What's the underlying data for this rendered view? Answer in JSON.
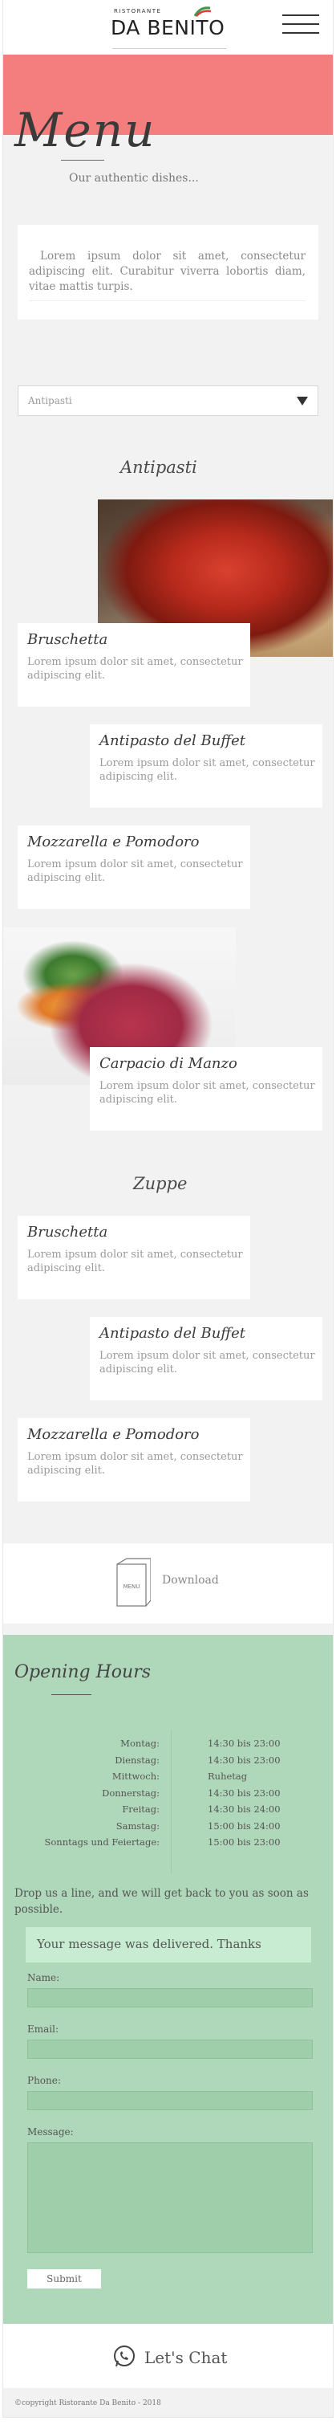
{
  "header": {
    "logo_small": "RISTORANTE",
    "logo_big": "DA BENITO"
  },
  "hero": {
    "title": "Menu",
    "subtitle": "Our authentic dishes..."
  },
  "intro": {
    "text": "Lorem ipsum dolor sit amet, consectetur adipiscing elit. Curabitur viverra lobortis diam, vitae mattis turpis."
  },
  "category_select": {
    "selected": "Antipasti"
  },
  "sections": {
    "antipasti": {
      "title": "Antipasti",
      "items": [
        {
          "name": "Bruschetta",
          "desc": "Lorem ipsum dolor sit amet, consectetur adipiscing elit."
        },
        {
          "name": "Antipasto del Buffet",
          "desc": "Lorem ipsum dolor sit amet, consectetur adipiscing elit."
        },
        {
          "name": "Mozzarella e Pomodoro",
          "desc": "Lorem ipsum dolor sit amet, consectetur adipiscing elit."
        },
        {
          "name": "Carpacio di Manzo",
          "desc": "Lorem ipsum dolor sit amet, consectetur adipiscing elit."
        }
      ]
    },
    "zuppe": {
      "title": "Zuppe",
      "items": [
        {
          "name": "Bruschetta",
          "desc": "Lorem ipsum dolor sit amet, consectetur adipiscing elit."
        },
        {
          "name": "Antipasto del Buffet",
          "desc": "Lorem ipsum dolor sit amet, consectetur adipiscing elit."
        },
        {
          "name": "Mozzarella e Pomodoro",
          "desc": "Lorem ipsum dolor sit amet, consectetur adipiscing elit."
        }
      ]
    }
  },
  "download": {
    "icon_label": "MENU",
    "label": "Download"
  },
  "opening_hours": {
    "title": "Opening Hours",
    "rows": [
      {
        "day": "Montag:",
        "time": "14:30 bis 23:00"
      },
      {
        "day": "Dienstag:",
        "time": "14:30 bis 23:00"
      },
      {
        "day": "Mittwoch:",
        "time": "Ruhetag"
      },
      {
        "day": "Donnerstag:",
        "time": "14:30 bis 23:00"
      },
      {
        "day": "Freitag:",
        "time": "14:30 bis 24:00"
      },
      {
        "day": "Samstag:",
        "time": "15:00 bis 24:00"
      },
      {
        "day": "Sonntags und Feiertage:",
        "time": "15:00 bis 23:00"
      }
    ]
  },
  "contact_form": {
    "intro": "Drop us a line, and we will get back to you as soon as possible.",
    "success": "Your message was delivered. Thanks",
    "name_label": "Name:",
    "email_label": "Email:",
    "phone_label": "Phone:",
    "message_label": "Message:",
    "submit_label": "Submit"
  },
  "chat": {
    "label": "Let's Chat"
  },
  "footer": {
    "copyright": "©copyright Ristorante Da Benito - 2018"
  },
  "colors": {
    "banner": "#f47d7d",
    "green_section": "#afd7b9",
    "success_bg": "#c7ecd1",
    "page_bg": "#f2f2f2"
  }
}
